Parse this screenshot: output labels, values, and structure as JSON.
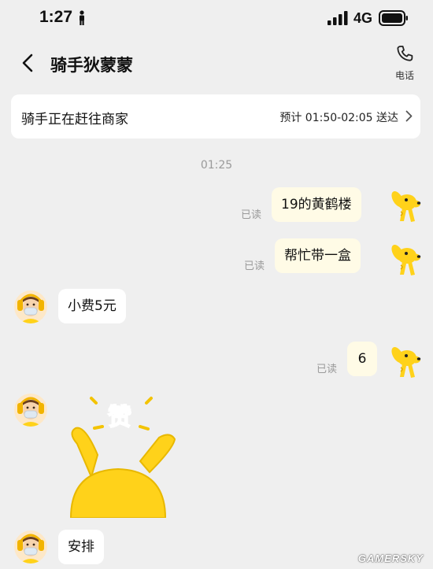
{
  "status_bar": {
    "time": "1:27",
    "network": "4G"
  },
  "nav": {
    "title": "骑手狄蒙蒙",
    "call_label": "电话"
  },
  "delivery": {
    "status": "骑手正在赶往商家",
    "eta": "预计 01:50-02:05 送达"
  },
  "chat": {
    "timestamp": "01:25",
    "messages": [
      {
        "side": "sent",
        "text": "19的黄鹤楼",
        "read_label": "已读"
      },
      {
        "side": "sent",
        "text": "帮忙带一盒",
        "read_label": "已读"
      },
      {
        "side": "received",
        "text": "小费5元"
      },
      {
        "side": "sent",
        "text": "6",
        "read_label": "已读"
      },
      {
        "side": "received",
        "sticker": "praise-sticker",
        "sticker_text": "赞"
      },
      {
        "side": "received",
        "text": "安排"
      }
    ]
  },
  "watermark": "GAMERSKY",
  "colors": {
    "background": "#efefef",
    "sent_bubble": "#fffbe6",
    "mascot_yellow": "#ffd21a"
  }
}
